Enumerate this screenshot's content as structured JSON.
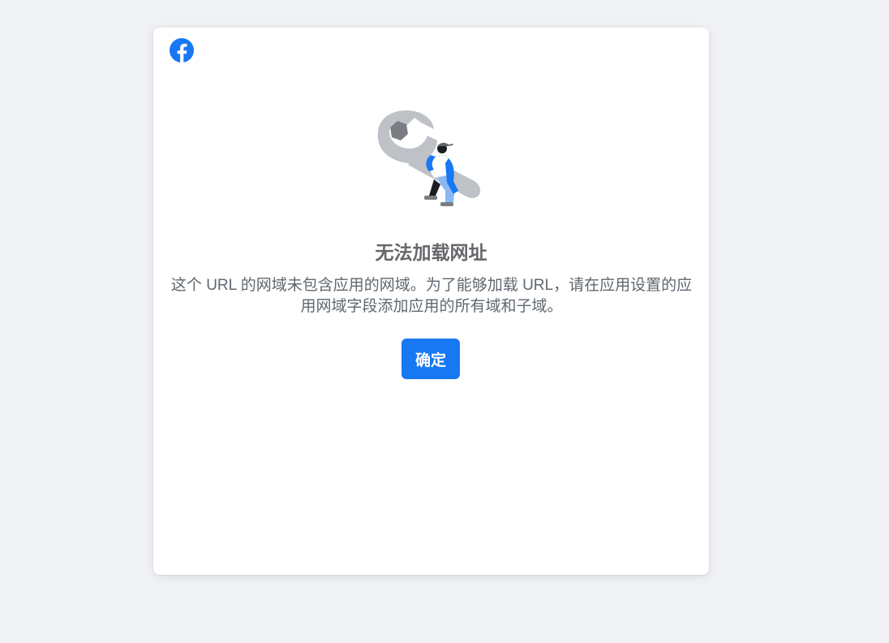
{
  "brand": {
    "logo_icon": "facebook-icon",
    "color": "#1877f2"
  },
  "dialog": {
    "illustration_icon": "wrench-worker-icon",
    "title": "无法加载网址",
    "message": "这个 URL 的网域未包含应用的网域。为了能够加载 URL，请在应用设置的应用网域字段添加应用的所有域和子域。",
    "ok_label": "确定"
  }
}
